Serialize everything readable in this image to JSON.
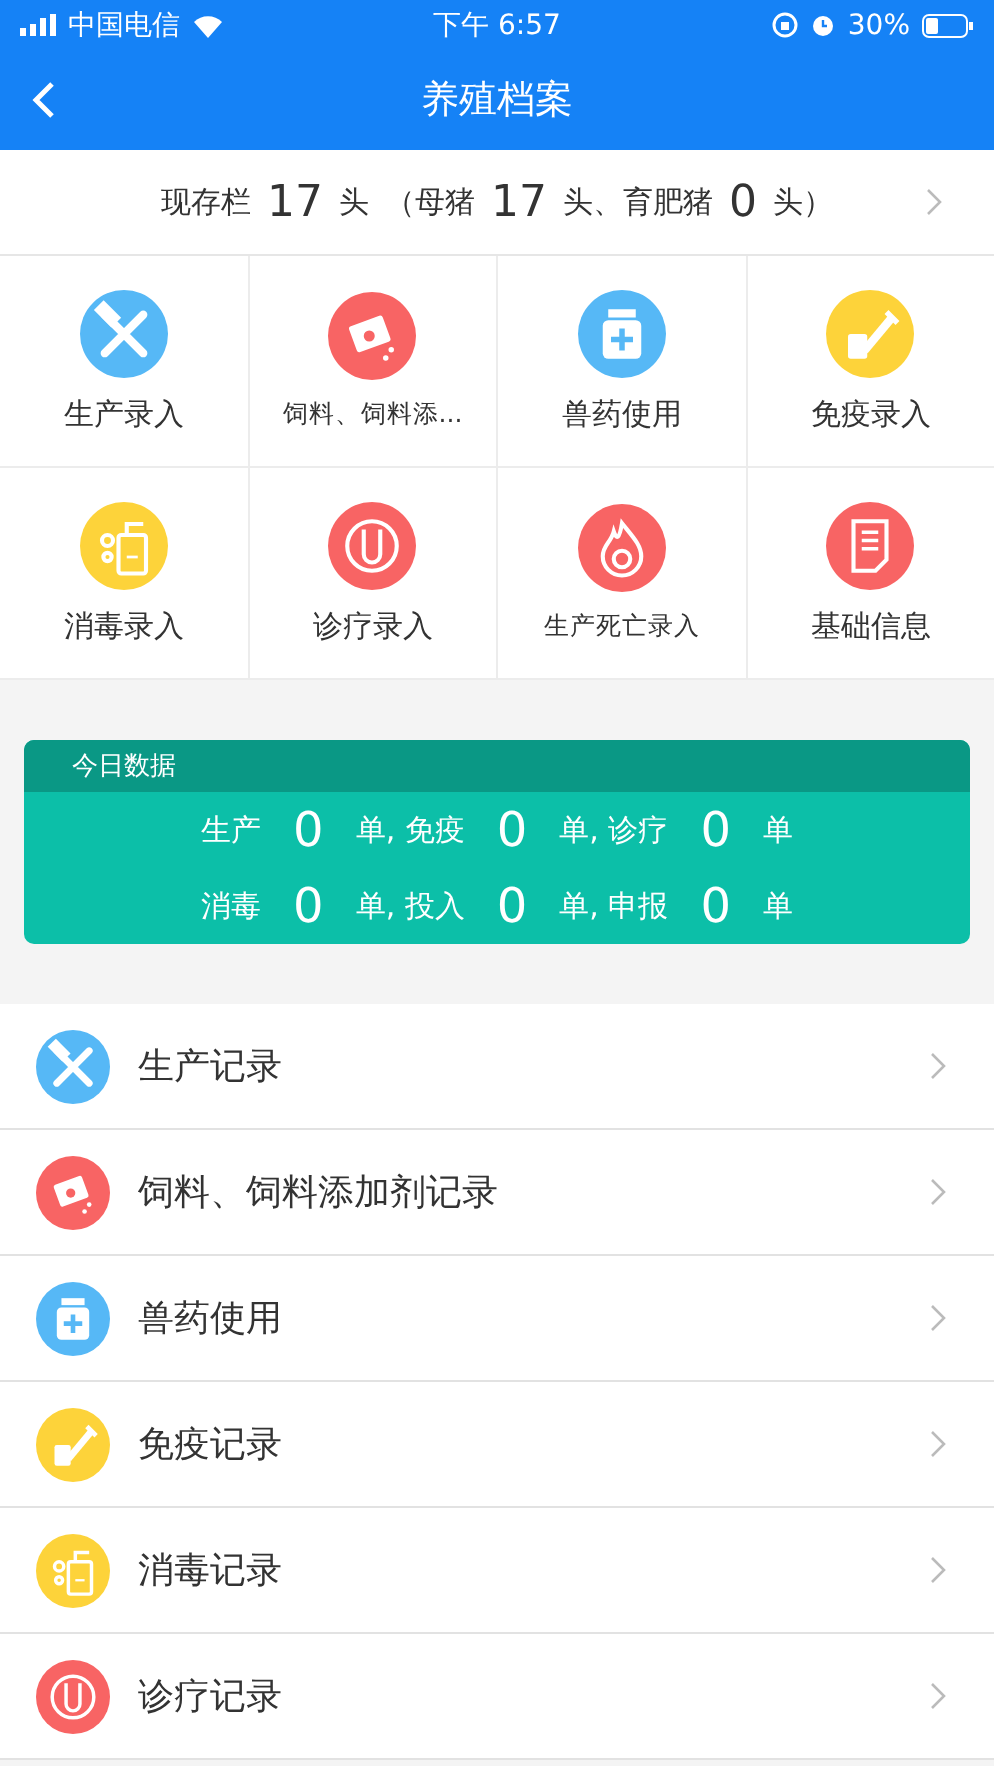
{
  "status_bar": {
    "carrier": "中国电信",
    "time": "下午 6:57",
    "battery": "30%"
  },
  "nav": {
    "title": "养殖档案"
  },
  "stock_summary": [
    {
      "kind": "label",
      "text": "现存栏"
    },
    {
      "kind": "number",
      "text": "17"
    },
    {
      "kind": "label",
      "text": "头"
    },
    {
      "kind": "label",
      "text": "（母猪"
    },
    {
      "kind": "number",
      "text": "17"
    },
    {
      "kind": "label",
      "text": "头、育肥猪"
    },
    {
      "kind": "number",
      "text": "0"
    },
    {
      "kind": "label",
      "text": "头）"
    }
  ],
  "grid": [
    {
      "label": "生产录入",
      "color": "#56b8f6"
    },
    {
      "label": "饲料、饲料添...",
      "color": "#f86464"
    },
    {
      "label": "兽药使用",
      "color": "#56b8f6"
    },
    {
      "label": "免疫录入",
      "color": "#fdd33a"
    },
    {
      "label": "消毒录入",
      "color": "#fdd33a"
    },
    {
      "label": "诊疗录入",
      "color": "#f86464"
    },
    {
      "label": "生产死亡录入",
      "color": "#f86464"
    },
    {
      "label": "基础信息",
      "color": "#f86464"
    }
  ],
  "today": {
    "title": "今日数据",
    "rows": [
      [
        {
          "kind": "label",
          "text": "生产"
        },
        {
          "kind": "number",
          "text": "0"
        },
        {
          "kind": "label",
          "text": "单, 免疫"
        },
        {
          "kind": "number",
          "text": "0"
        },
        {
          "kind": "label",
          "text": "单, 诊疗"
        },
        {
          "kind": "number",
          "text": "0"
        },
        {
          "kind": "label",
          "text": "单"
        }
      ],
      [
        {
          "kind": "label",
          "text": "消毒"
        },
        {
          "kind": "number",
          "text": "0"
        },
        {
          "kind": "label",
          "text": "单, 投入"
        },
        {
          "kind": "number",
          "text": "0"
        },
        {
          "kind": "label",
          "text": "单, 申报"
        },
        {
          "kind": "number",
          "text": "0"
        },
        {
          "kind": "label",
          "text": "单"
        }
      ]
    ]
  },
  "records": [
    {
      "label": "生产记录",
      "color": "#56b8f6"
    },
    {
      "label": "饲料、饲料添加剂记录",
      "color": "#f86464"
    },
    {
      "label": "兽药使用",
      "color": "#56b8f6"
    },
    {
      "label": "免疫记录",
      "color": "#fdd33a"
    },
    {
      "label": "消毒记录",
      "color": "#fdd33a"
    },
    {
      "label": "诊疗记录",
      "color": "#f86464"
    }
  ]
}
